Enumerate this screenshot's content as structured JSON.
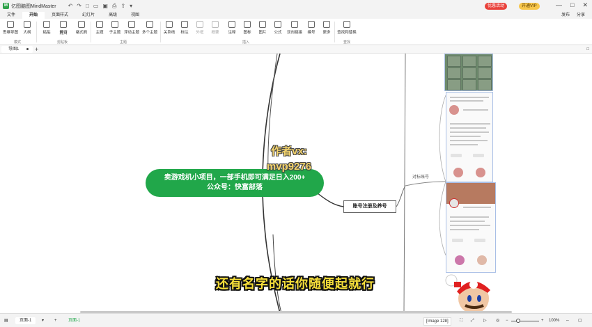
{
  "titlebar": {
    "app_title": "亿图脑图MindMaster",
    "promo_label": "优惠活动",
    "vip_label": "开通VIP",
    "window_controls": [
      "—",
      "□",
      "✕"
    ]
  },
  "menu": {
    "tabs": [
      "文件",
      "开始",
      "页面样式",
      "幻灯片",
      "高级",
      "视图"
    ],
    "active_tab": "开始",
    "right_items": [
      "发布",
      "分享"
    ]
  },
  "ribbon": {
    "buttons": [
      {
        "label": "思维导图",
        "icon": "mindmap-icon"
      },
      {
        "label": "大纲",
        "icon": "outline-icon"
      },
      {
        "label": "粘贴",
        "icon": "paste-icon"
      },
      {
        "label": "剪切",
        "icon": "cut-icon"
      },
      {
        "label": "拷贝",
        "icon": "copy-icon"
      },
      {
        "label": "格式刷",
        "icon": "format-painter-icon"
      },
      {
        "label": "主题",
        "icon": "topic-icon"
      },
      {
        "label": "子主题",
        "icon": "subtopic-icon"
      },
      {
        "label": "浮动主题",
        "icon": "floating-topic-icon"
      },
      {
        "label": "多个主题",
        "icon": "multiple-topics-icon"
      },
      {
        "label": "关系线",
        "icon": "relationship-icon"
      },
      {
        "label": "标注",
        "icon": "callout-icon"
      },
      {
        "label": "外框",
        "icon": "boundary-icon"
      },
      {
        "label": "概要",
        "icon": "summary-icon"
      },
      {
        "label": "注释",
        "icon": "note-icon"
      },
      {
        "label": "图标",
        "icon": "icon-icon"
      },
      {
        "label": "图片",
        "icon": "image-icon"
      },
      {
        "label": "公式",
        "icon": "formula-icon"
      },
      {
        "label": "双向链接",
        "icon": "bilink-icon"
      },
      {
        "label": "编号",
        "icon": "numbering-icon"
      },
      {
        "label": "更多",
        "icon": "more-icon"
      },
      {
        "label": "查找和替换",
        "icon": "find-replace-icon"
      }
    ],
    "groups": [
      "模式",
      "剪贴板",
      "主题",
      "插入",
      "查找"
    ]
  },
  "document": {
    "tab_label": "导图1",
    "panel_toggle": "□"
  },
  "canvas": {
    "central_topic_line1": "卖游戏机小项目，一部手机即可满足日入200+",
    "central_topic_line2": "公众号：快富部落",
    "watermark_line1": "作者vx:",
    "watermark_line2": "mvp9276",
    "main_topic": "账号注册及养号",
    "branch_label": "对标账号",
    "subtitle": "还有名字的话你随便起就行"
  },
  "statusbar": {
    "page_label": "页面-1",
    "page_label_active": "页面-1",
    "info": "[Image 128]",
    "zoom": "100%"
  }
}
